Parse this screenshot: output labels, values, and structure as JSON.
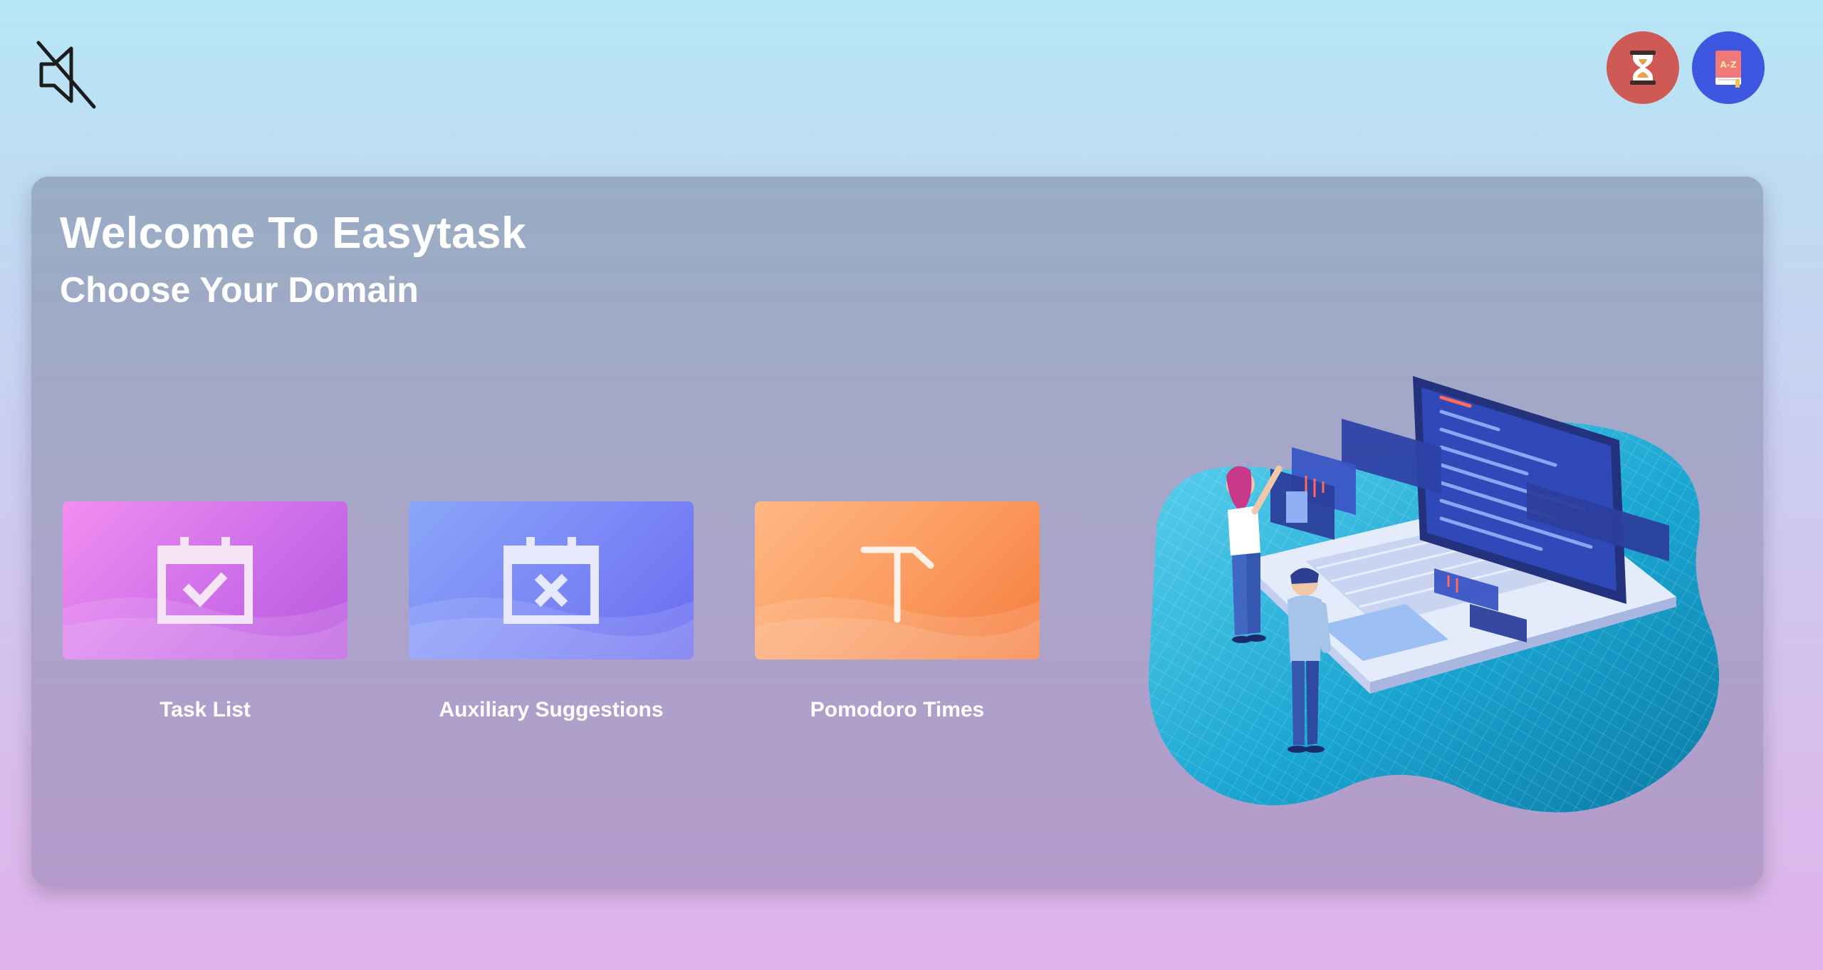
{
  "header": {
    "mute_icon": "speaker-muted-icon",
    "timer_icon": "hourglass-icon",
    "dictionary_icon": "a-z-book-icon",
    "timer_color": "#cf5a55",
    "dictionary_color": "#3f56e0"
  },
  "panel": {
    "title": "Welcome To Easytask",
    "subtitle": "Choose Your Domain"
  },
  "domains": [
    {
      "label": "Task List",
      "icon": "calendar-check-icon",
      "color": "#d56ff0"
    },
    {
      "label": "Auxiliary Suggestions",
      "icon": "calendar-x-icon",
      "color": "#7a88f6"
    },
    {
      "label": "Pomodoro Times",
      "icon": "tomato-stem-icon",
      "color": "#fb9a5e"
    }
  ],
  "illustration": {
    "icon": "laptop-team-illustration",
    "accent": "#1bb6dd"
  }
}
